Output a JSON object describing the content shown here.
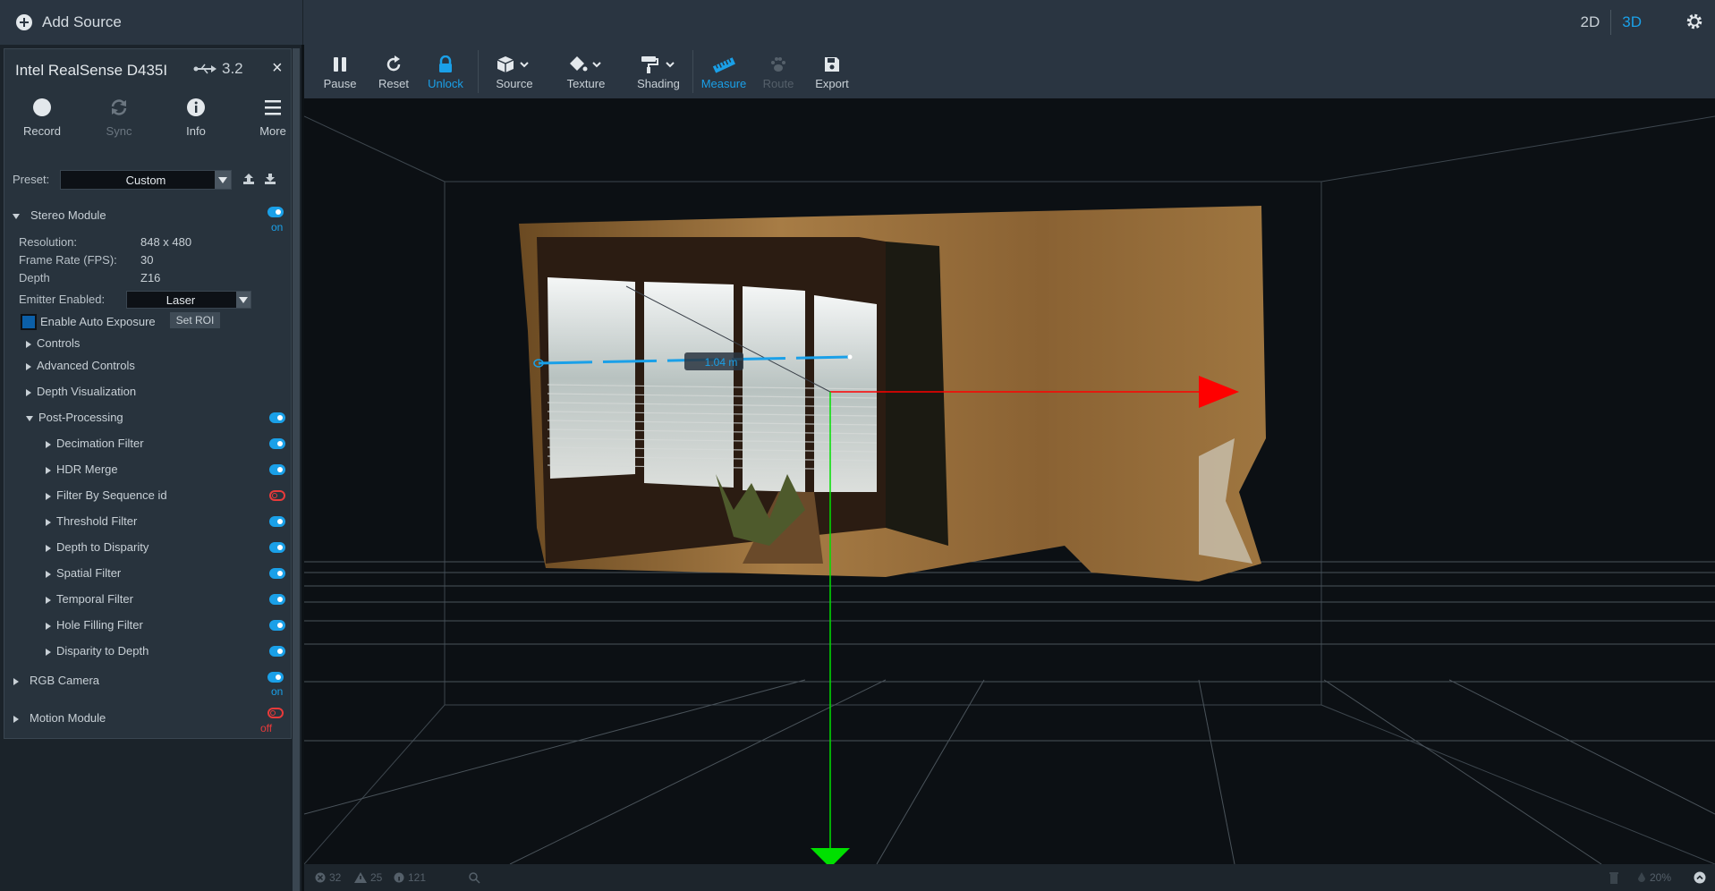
{
  "topbar": {
    "add_source": "Add Source",
    "view_2d": "2D",
    "view_3d": "3D"
  },
  "device": {
    "name": "Intel RealSense D435I",
    "usb": "3.2",
    "close": "×",
    "actions": [
      {
        "label": "Record",
        "icon": "record-icon"
      },
      {
        "label": "Sync",
        "icon": "sync-icon"
      },
      {
        "label": "Info",
        "icon": "info-icon"
      },
      {
        "label": "More",
        "icon": "menu-icon"
      }
    ],
    "preset_label": "Preset:",
    "preset_value": "Custom"
  },
  "stereo": {
    "title": "Stereo Module",
    "state": "on",
    "resolution_label": "Resolution:",
    "resolution_value": "848 x 480",
    "fps_label": "Frame Rate (FPS):",
    "fps_value": "30",
    "depth_label": "Depth",
    "depth_value": "Z16",
    "emitter_label": "Emitter Enabled:",
    "emitter_value": "Laser",
    "auto_exposure": "Enable Auto Exposure",
    "set_roi": "Set ROI",
    "controls": "Controls",
    "advanced": "Advanced Controls",
    "depth_vis": "Depth Visualization",
    "post_processing": "Post-Processing",
    "filters": [
      {
        "label": "Decimation Filter",
        "on": true
      },
      {
        "label": "HDR Merge",
        "on": true
      },
      {
        "label": "Filter By Sequence id",
        "on": false
      },
      {
        "label": "Threshold Filter",
        "on": true
      },
      {
        "label": "Depth to Disparity",
        "on": true
      },
      {
        "label": "Spatial Filter",
        "on": true
      },
      {
        "label": "Temporal Filter",
        "on": true
      },
      {
        "label": "Hole Filling Filter",
        "on": true
      },
      {
        "label": "Disparity to Depth",
        "on": true
      }
    ]
  },
  "rgb": {
    "title": "RGB Camera",
    "state": "on"
  },
  "motion": {
    "title": "Motion Module",
    "state": "off"
  },
  "toolbar": {
    "items": [
      {
        "label": "Pause",
        "icon": "pause-icon"
      },
      {
        "label": "Reset",
        "icon": "reset-icon"
      },
      {
        "label": "Unlock",
        "icon": "lock-icon"
      },
      {
        "label": "Source",
        "icon": "cube-icon"
      },
      {
        "label": "Texture",
        "icon": "paint-bucket-icon"
      },
      {
        "label": "Shading",
        "icon": "paint-roller-icon"
      },
      {
        "label": "Measure",
        "icon": "ruler-icon"
      },
      {
        "label": "Route",
        "icon": "paw-icon"
      },
      {
        "label": "Export",
        "icon": "save-icon"
      }
    ]
  },
  "viewport": {
    "measurement": "1.04 m"
  },
  "status": {
    "errors": "32",
    "warnings": "25",
    "info": "121",
    "zoom": "20%"
  },
  "colors": {
    "accent": "#1aa0e8",
    "off": "#e83a3a",
    "axis_x": "#ff0000",
    "axis_y": "#00e000"
  }
}
